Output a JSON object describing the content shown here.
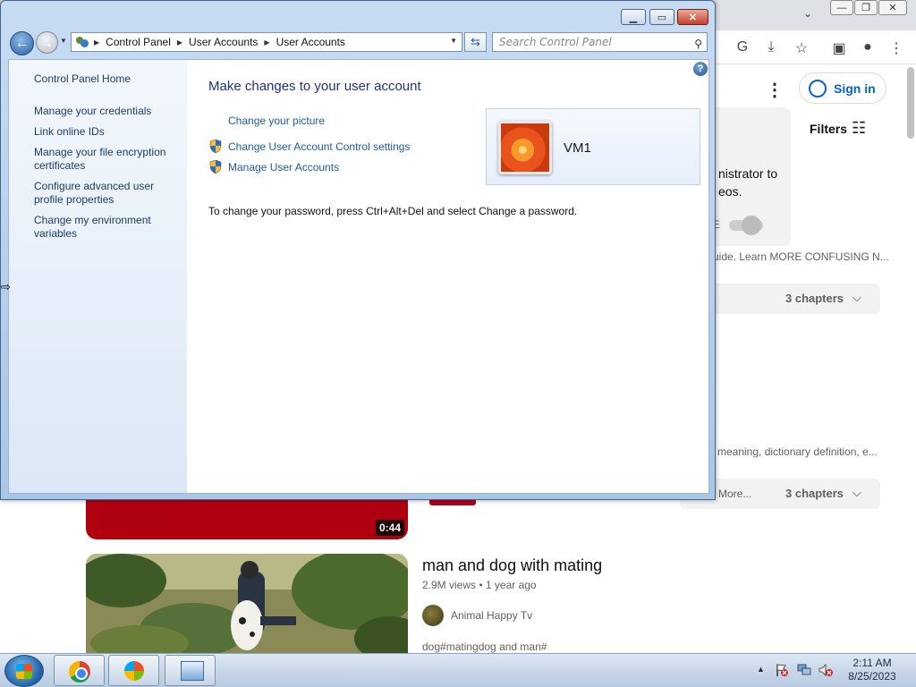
{
  "control_panel": {
    "breadcrumb": [
      "Control Panel",
      "User Accounts",
      "User Accounts"
    ],
    "search_placeholder": "Search Control Panel",
    "sidebar": {
      "home": "Control Panel Home",
      "links": [
        "Manage your credentials",
        "Link online IDs",
        "Manage your file encryption certificates",
        "Configure advanced user profile properties",
        "Change my environment variables"
      ]
    },
    "title": "Make changes to your user account",
    "tasks": {
      "change_picture": "Change your picture",
      "uac_settings": "Change User Account Control settings",
      "manage_accounts": "Manage User Accounts"
    },
    "password_note": "To change your password, press Ctrl+Alt+Del and select Change a password.",
    "user_name": "VM1"
  },
  "browser_background": {
    "sign_in": "Sign in",
    "filters": "Filters",
    "notice_text": "nistrator to eos.",
    "notice_fragment": "E",
    "desc1": "uide. Learn MORE CONFUSING N...",
    "chapters": "3 chapters",
    "desc2": "meaning, dictionary definition, e...",
    "more": "More...",
    "video1_duration": "0:44",
    "video2": {
      "title": "man and dog with mating",
      "meta": "2.9M views • 1 year ago",
      "channel": "Animal Happy Tv",
      "description": "dog#matingdog and man#"
    }
  },
  "taskbar": {
    "time": "2:11 AM",
    "date": "8/25/2023"
  }
}
